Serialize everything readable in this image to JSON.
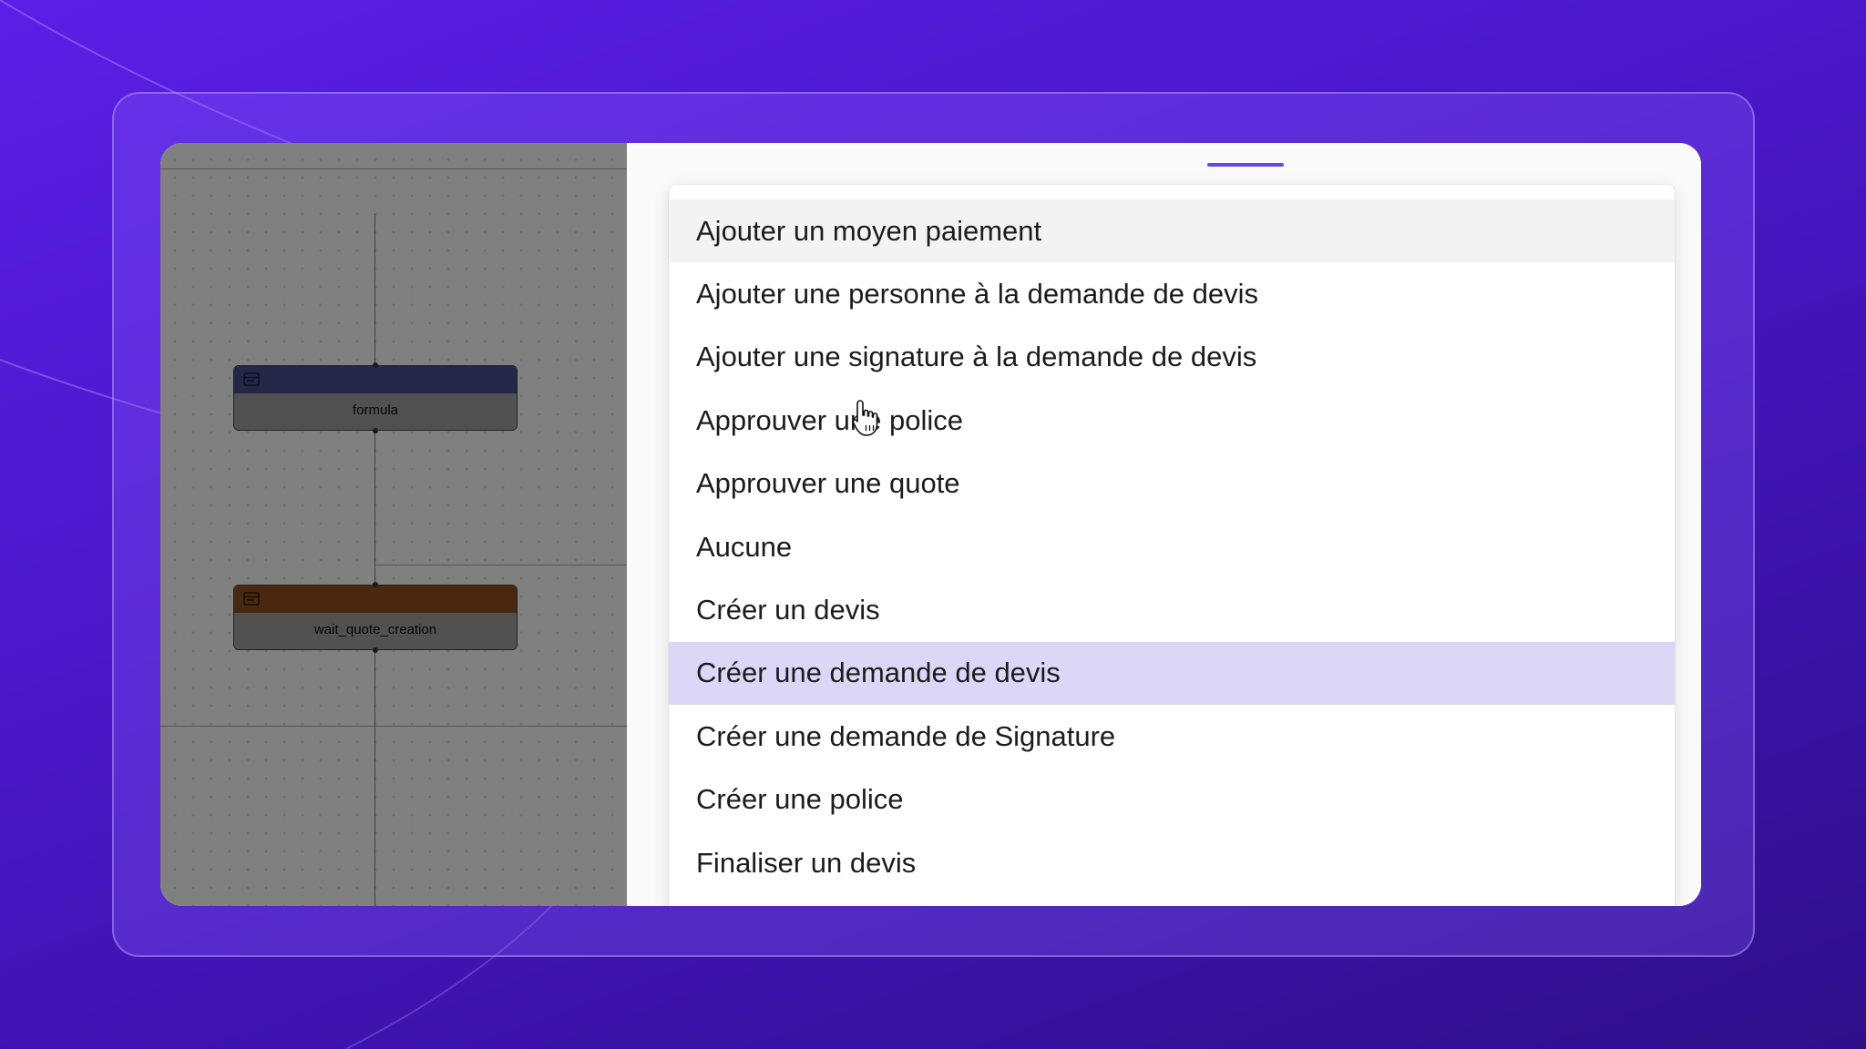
{
  "canvas": {
    "nodes": [
      {
        "label": "formula",
        "header_color": "#6b78d6",
        "icon": "table-icon"
      },
      {
        "label": "wait_quote_creation",
        "header_color": "#d9782e",
        "icon": "table-icon"
      }
    ]
  },
  "dropdown": {
    "options": [
      "Ajouter un moyen paiement",
      "Ajouter une personne à la demande de devis",
      "Ajouter une signature à la demande de devis",
      "Approuver une police",
      "Approuver une quote",
      "Aucune",
      "Créer un devis",
      "Créer une demande de devis",
      "Créer une demande de Signature",
      "Créer une police",
      "Finaliser un devis"
    ],
    "hovered_index": 0,
    "selected_index": 7
  },
  "colors": {
    "accent": "#6a45e8",
    "selected_bg": "#dcd6f7",
    "hover_bg": "#f3f3f3"
  }
}
